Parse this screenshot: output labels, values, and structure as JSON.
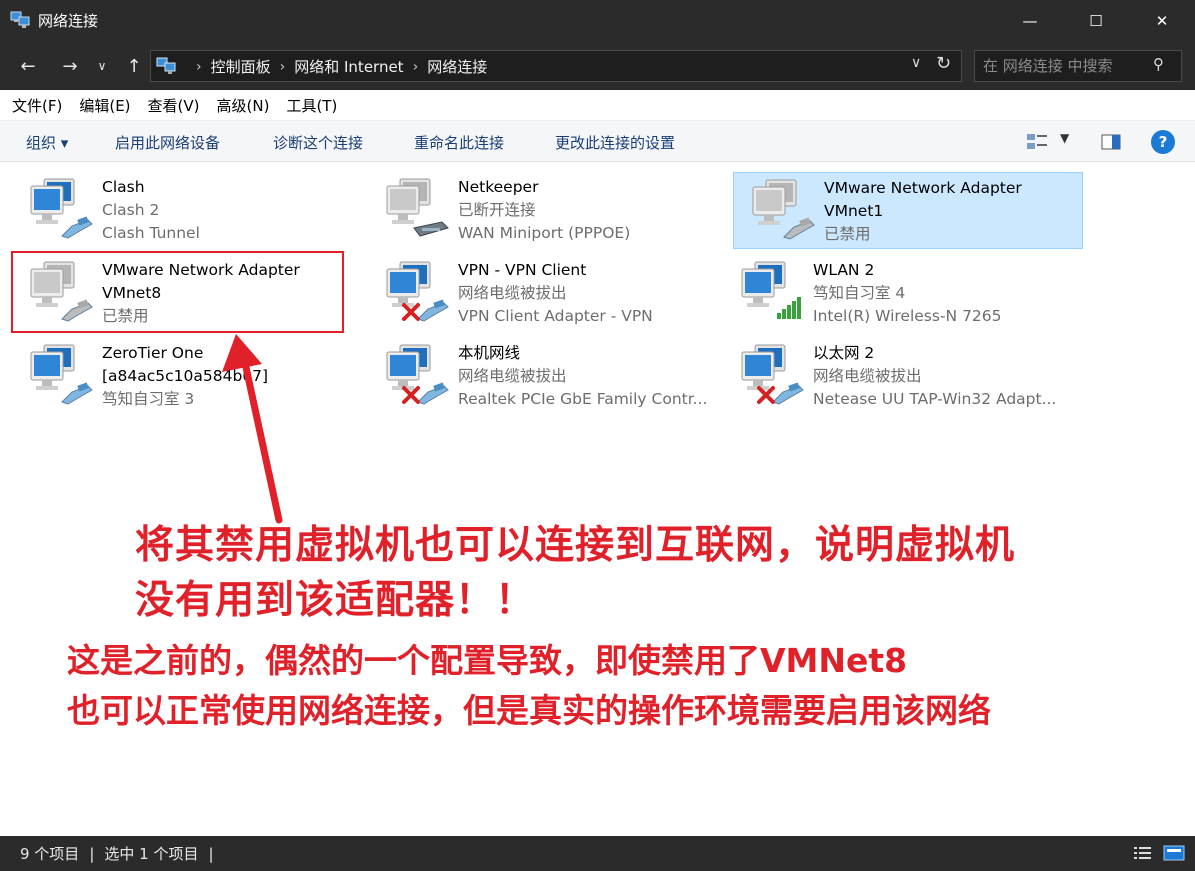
{
  "window": {
    "title": "网络连接",
    "minimize_glyph": "—",
    "maximize_glyph": "☐",
    "close_glyph": "✕"
  },
  "address": {
    "crumbs": [
      "控制面板",
      "网络和 Internet",
      "网络连接"
    ],
    "search_placeholder": "在 网络连接 中搜索"
  },
  "menu": [
    "文件(F)",
    "编辑(E)",
    "查看(V)",
    "高级(N)",
    "工具(T)"
  ],
  "commands": {
    "organize": "组织 ▾",
    "enable": "启用此网络设备",
    "diagnose": "诊断这个连接",
    "rename": "重命名此连接",
    "change": "更改此连接的设置",
    "help": "?"
  },
  "connections": [
    {
      "name": "Clash",
      "line2": "Clash 2",
      "line3": "Clash Tunnel",
      "icon": "network-adapter-icon",
      "state": "connected"
    },
    {
      "name": "Netkeeper",
      "line2": "已断开连接",
      "line3": "WAN Miniport (PPPOE)",
      "icon": "dialup-modem-icon",
      "state": "disconnected"
    },
    {
      "name": "VMware Network Adapter",
      "line2": "VMnet1",
      "line3": "已禁用",
      "icon": "network-adapter-icon",
      "state": "disabled"
    },
    {
      "name": "VMware Network Adapter",
      "line2": "VMnet8",
      "line3": "已禁用",
      "icon": "network-adapter-icon",
      "state": "disabled"
    },
    {
      "name": "VPN - VPN Client",
      "line2": "网络电缆被拔出",
      "line3": "VPN Client Adapter - VPN",
      "icon": "network-adapter-icon",
      "state": "unplugged"
    },
    {
      "name": "WLAN 2",
      "line2": "笃知自习室 4",
      "line3": "Intel(R) Wireless-N 7265",
      "icon": "wireless-signal-icon",
      "state": "connected"
    },
    {
      "name": "ZeroTier One",
      "line2": "[a84ac5c10a584b07]",
      "line3": "笃知自习室 3",
      "icon": "network-adapter-icon",
      "state": "connected"
    },
    {
      "name": "本机网线",
      "line2": "网络电缆被拔出",
      "line3": "Realtek PCIe GbE Family Contr...",
      "icon": "network-adapter-icon",
      "state": "unplugged"
    },
    {
      "name": "以太网 2",
      "line2": "网络电缆被拔出",
      "line3": "Netease UU TAP-Win32 Adapt...",
      "icon": "network-adapter-icon",
      "state": "unplugged"
    }
  ],
  "annotation": {
    "line1": "将其禁用虚拟机也可以连接到互联网，说明虚拟机",
    "line2": "没有用到该适配器！！",
    "line3": "这是之前的，偶然的一个配置导致，即使禁用了VMNet8",
    "line4": "也可以正常使用网络连接，但是真实的操作环境需要启用该网络",
    "color": "#e0212a"
  },
  "status": {
    "count": "9 个项目",
    "selected": "选中 1 个项目",
    "bar": "|"
  },
  "colors": {
    "chrome": "#2b2b2b",
    "selection": "#cce8ff",
    "link_text": "#1a3e78"
  }
}
